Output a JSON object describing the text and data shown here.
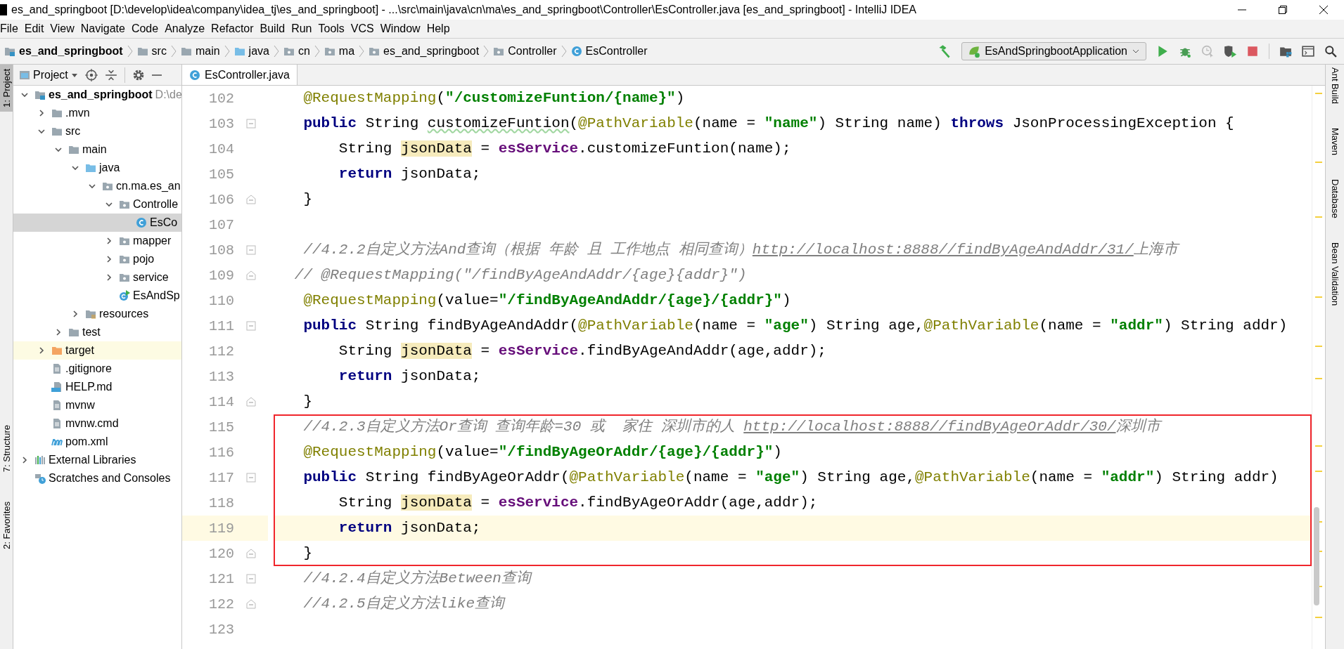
{
  "window": {
    "title": "es_and_springboot [D:\\develop\\idea\\company\\idea_tj\\es_and_springboot] - ...\\src\\main\\java\\cn\\ma\\es_and_springboot\\Controller\\EsController.java [es_and_springboot] - IntelliJ IDEA"
  },
  "menu": [
    "File",
    "Edit",
    "View",
    "Navigate",
    "Code",
    "Analyze",
    "Refactor",
    "Build",
    "Run",
    "Tools",
    "VCS",
    "Window",
    "Help"
  ],
  "breadcrumb": [
    {
      "label": "es_and_springboot",
      "kind": "module"
    },
    {
      "label": "src",
      "kind": "folder"
    },
    {
      "label": "main",
      "kind": "folder"
    },
    {
      "label": "java",
      "kind": "source"
    },
    {
      "label": "cn",
      "kind": "package"
    },
    {
      "label": "ma",
      "kind": "package"
    },
    {
      "label": "es_and_springboot",
      "kind": "package"
    },
    {
      "label": "Controller",
      "kind": "package"
    },
    {
      "label": "EsController",
      "kind": "class"
    }
  ],
  "run_config": {
    "label": "EsAndSpringbootApplication"
  },
  "left_tool_windows": [
    {
      "label": "1: Project",
      "selected": true
    },
    {
      "label": "7: Structure",
      "selected": false
    },
    {
      "label": "2: Favorites",
      "selected": false
    }
  ],
  "right_tool_windows": [
    "Ant Build",
    "Maven",
    "Database",
    "Bean Validation"
  ],
  "project_panel": {
    "title": "Project"
  },
  "tree": [
    {
      "label": "es_and_springboot",
      "path": "D:\\de",
      "kind": "module",
      "expanded": true,
      "selected": false,
      "highlighted": false,
      "children": [
        {
          "label": ".mvn",
          "kind": "folder",
          "expanded": false,
          "selected": false,
          "highlighted": false
        },
        {
          "label": "src",
          "kind": "folder",
          "expanded": true,
          "selected": false,
          "highlighted": false,
          "children": [
            {
              "label": "main",
              "kind": "folder",
              "expanded": true,
              "selected": false,
              "highlighted": false,
              "children": [
                {
                  "label": "java",
                  "kind": "source",
                  "expanded": true,
                  "selected": false,
                  "highlighted": false,
                  "children": [
                    {
                      "label": "cn.ma.es_an",
                      "kind": "package",
                      "expanded": true,
                      "selected": false,
                      "highlighted": false,
                      "children": [
                        {
                          "label": "Controlle",
                          "kind": "package",
                          "expanded": true,
                          "selected": false,
                          "highlighted": false,
                          "children": [
                            {
                              "label": "EsCo",
                              "kind": "class",
                              "selected": true,
                              "highlighted": false
                            }
                          ]
                        },
                        {
                          "label": "mapper",
                          "kind": "package",
                          "expanded": false,
                          "selected": false,
                          "highlighted": false
                        },
                        {
                          "label": "pojo",
                          "kind": "package",
                          "expanded": false,
                          "selected": false,
                          "highlighted": false
                        },
                        {
                          "label": "service",
                          "kind": "package",
                          "expanded": false,
                          "selected": false,
                          "highlighted": false
                        },
                        {
                          "label": "EsAndSp",
                          "kind": "app",
                          "selected": false,
                          "highlighted": false
                        }
                      ]
                    }
                  ]
                },
                {
                  "label": "resources",
                  "kind": "resources",
                  "expanded": false,
                  "selected": false,
                  "highlighted": false
                }
              ]
            },
            {
              "label": "test",
              "kind": "folder",
              "expanded": false,
              "selected": false,
              "highlighted": false
            }
          ]
        },
        {
          "label": "target",
          "kind": "target",
          "expanded": false,
          "selected": false,
          "highlighted": true
        },
        {
          "label": ".gitignore",
          "kind": "file",
          "selected": false,
          "highlighted": false
        },
        {
          "label": "HELP.md",
          "kind": "markdown",
          "selected": false,
          "highlighted": false
        },
        {
          "label": "mvnw",
          "kind": "file",
          "selected": false,
          "highlighted": false
        },
        {
          "label": "mvnw.cmd",
          "kind": "file",
          "selected": false,
          "highlighted": false
        },
        {
          "label": "pom.xml",
          "kind": "xml",
          "selected": false,
          "highlighted": false
        }
      ]
    },
    {
      "label": "External Libraries",
      "kind": "libraries",
      "expanded": false,
      "selected": false,
      "highlighted": false
    },
    {
      "label": "Scratches and Consoles",
      "kind": "scratches",
      "selected": false,
      "highlighted": false
    }
  ],
  "editor": {
    "tabs": [
      {
        "label": "EsController.java",
        "selected": true
      }
    ],
    "lines": [
      {
        "number": "102",
        "current": false,
        "boxed": false,
        "tokens": [
          {
            "kind": "ann",
            "text": "    @RequestMapping"
          },
          {
            "kind": "plain",
            "text": "("
          },
          {
            "kind": "str",
            "text": "\"/customizeFuntion/{name}\""
          },
          {
            "kind": "plain",
            "text": ")"
          }
        ]
      },
      {
        "number": "103",
        "fold_marker": {
          "kind": "start"
        },
        "current": false,
        "boxed": false,
        "tokens": [
          {
            "kind": "kw",
            "text": "    public"
          },
          {
            "kind": "plain",
            "text": " String "
          },
          {
            "kind": "typo",
            "text": "customizeFuntion"
          },
          {
            "kind": "plain",
            "text": "("
          },
          {
            "kind": "ann",
            "text": "@PathVariable"
          },
          {
            "kind": "plain",
            "text": "(name = "
          },
          {
            "kind": "str",
            "text": "\"name\""
          },
          {
            "kind": "plain",
            "text": ") String name) "
          },
          {
            "kind": "kw",
            "text": "throws"
          },
          {
            "kind": "plain",
            "text": " JsonProcessingException {"
          }
        ]
      },
      {
        "number": "104",
        "current": false,
        "boxed": false,
        "tokens": [
          {
            "kind": "plain",
            "text": "        String "
          },
          {
            "kind": "hl",
            "text": "jsonData"
          },
          {
            "kind": "plain",
            "text": " = "
          },
          {
            "kind": "field",
            "text": "esService"
          },
          {
            "kind": "plain",
            "text": ".customizeFuntion(name);"
          }
        ]
      },
      {
        "number": "105",
        "current": false,
        "boxed": false,
        "tokens": [
          {
            "kind": "kw",
            "text": "        return"
          },
          {
            "kind": "plain",
            "text": " jsonData;"
          }
        ]
      },
      {
        "number": "106",
        "fold_marker": {
          "kind": "end"
        },
        "current": false,
        "boxed": false,
        "tokens": [
          {
            "kind": "plain",
            "text": "    }"
          }
        ]
      },
      {
        "number": "107",
        "current": false
      },
      {
        "number": "108",
        "fold_marker": {
          "kind": "start"
        },
        "current": false,
        "boxed": false,
        "tokens": [
          {
            "kind": "cmt",
            "text": "    //4.2.2自定义方法And查询（根据 年龄 且 工作地点 相同查询）"
          },
          {
            "kind": "link",
            "text": "http://localhost:8888//findByAgeAndAddr/31/"
          },
          {
            "kind": "cmt",
            "text": "上海市"
          }
        ]
      },
      {
        "number": "109",
        "fold_marker": {
          "kind": "end"
        },
        "current": false,
        "boxed": false,
        "tokens": [
          {
            "kind": "cmt",
            "text": "   // @RequestMapping(\"/findByAgeAndAddr/{age}{addr}\")"
          }
        ]
      },
      {
        "number": "110",
        "current": false,
        "boxed": false,
        "tokens": [
          {
            "kind": "ann",
            "text": "    @RequestMapping"
          },
          {
            "kind": "plain",
            "text": "(value="
          },
          {
            "kind": "str",
            "text": "\"/findByAgeAndAddr/{age}/{addr}\""
          },
          {
            "kind": "plain",
            "text": ")"
          }
        ]
      },
      {
        "number": "111",
        "fold_marker": {
          "kind": "start"
        },
        "current": false,
        "boxed": false,
        "tokens": [
          {
            "kind": "kw",
            "text": "    public"
          },
          {
            "kind": "plain",
            "text": " String findByAgeAndAddr("
          },
          {
            "kind": "ann",
            "text": "@PathVariable"
          },
          {
            "kind": "plain",
            "text": "(name = "
          },
          {
            "kind": "str",
            "text": "\"age\""
          },
          {
            "kind": "plain",
            "text": ") String age,"
          },
          {
            "kind": "ann",
            "text": "@PathVariable"
          },
          {
            "kind": "plain",
            "text": "(name = "
          },
          {
            "kind": "str",
            "text": "\"addr\""
          },
          {
            "kind": "plain",
            "text": ") String addr)"
          }
        ]
      },
      {
        "number": "112",
        "current": false,
        "boxed": false,
        "tokens": [
          {
            "kind": "plain",
            "text": "        String "
          },
          {
            "kind": "hl",
            "text": "jsonData"
          },
          {
            "kind": "plain",
            "text": " = "
          },
          {
            "kind": "field",
            "text": "esService"
          },
          {
            "kind": "plain",
            "text": ".findByAgeAndAddr(age,addr);"
          }
        ]
      },
      {
        "number": "113",
        "current": false,
        "boxed": false,
        "tokens": [
          {
            "kind": "kw",
            "text": "        return"
          },
          {
            "kind": "plain",
            "text": " jsonData;"
          }
        ]
      },
      {
        "number": "114",
        "fold_marker": {
          "kind": "end"
        },
        "current": false,
        "boxed": false,
        "tokens": [
          {
            "kind": "plain",
            "text": "    }"
          }
        ]
      },
      {
        "number": "115",
        "current": false,
        "boxed": true,
        "tokens": [
          {
            "kind": "cmt",
            "text": "    //4.2.3自定义方法Or查询 查询年龄=30 或  家住 深圳市的人 "
          },
          {
            "kind": "link",
            "text": "http://localhost:8888//findByAgeOrAddr/30/"
          },
          {
            "kind": "cmt",
            "text": "深圳市"
          }
        ]
      },
      {
        "number": "116",
        "current": false,
        "boxed": true,
        "tokens": [
          {
            "kind": "ann",
            "text": "    @RequestMapping"
          },
          {
            "kind": "plain",
            "text": "(value="
          },
          {
            "kind": "str",
            "text": "\"/findByAgeOrAddr/{age}/{addr}\""
          },
          {
            "kind": "plain",
            "text": ")"
          }
        ]
      },
      {
        "number": "117",
        "fold_marker": {
          "kind": "start"
        },
        "current": false,
        "boxed": true,
        "tokens": [
          {
            "kind": "kw",
            "text": "    public"
          },
          {
            "kind": "plain",
            "text": " String findByAgeOrAddr("
          },
          {
            "kind": "ann",
            "text": "@PathVariable"
          },
          {
            "kind": "plain",
            "text": "(name = "
          },
          {
            "kind": "str",
            "text": "\"age\""
          },
          {
            "kind": "plain",
            "text": ") String age,"
          },
          {
            "kind": "ann",
            "text": "@PathVariable"
          },
          {
            "kind": "plain",
            "text": "(name = "
          },
          {
            "kind": "str",
            "text": "\"addr\""
          },
          {
            "kind": "plain",
            "text": ") String addr)"
          }
        ]
      },
      {
        "number": "118",
        "current": false,
        "boxed": true,
        "tokens": [
          {
            "kind": "plain",
            "text": "        String "
          },
          {
            "kind": "hl",
            "text": "jsonData"
          },
          {
            "kind": "plain",
            "text": " = "
          },
          {
            "kind": "field",
            "text": "esService"
          },
          {
            "kind": "plain",
            "text": ".findByAgeOrAddr(age,addr);"
          }
        ]
      },
      {
        "number": "119",
        "current": true,
        "boxed": true,
        "tokens": [
          {
            "kind": "kw",
            "text": "        return"
          },
          {
            "kind": "plain",
            "text": " jsonData;"
          }
        ]
      },
      {
        "number": "120",
        "fold_marker": {
          "kind": "end"
        },
        "current": false,
        "boxed": true,
        "tokens": [
          {
            "kind": "plain",
            "text": "    }"
          }
        ]
      },
      {
        "number": "121",
        "fold_marker": {
          "kind": "start"
        },
        "current": false,
        "boxed": false,
        "tokens": [
          {
            "kind": "cmt",
            "text": "    //4.2.4自定义方法Between查询"
          }
        ]
      },
      {
        "number": "122",
        "fold_marker": {
          "kind": "end"
        },
        "current": false,
        "boxed": false,
        "tokens": [
          {
            "kind": "cmt",
            "text": "    //4.2.5自定义方法like查询"
          }
        ]
      },
      {
        "number": "123",
        "current": false
      }
    ]
  }
}
